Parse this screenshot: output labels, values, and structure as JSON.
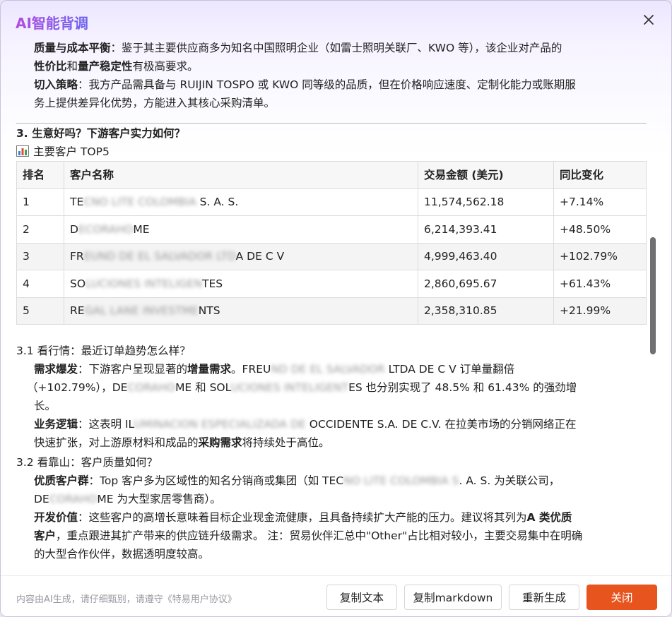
{
  "dialog": {
    "title": "AI智能背调",
    "close_icon": "close-icon"
  },
  "intro": {
    "quality_label": "质量与成本平衡",
    "quality_text_1": "：鉴于其主要供应商多为知名中国照明企业（如雷士照明关联厂、KWO 等），该企业对产品的",
    "quality_bold_1": "性价比",
    "quality_and": "和",
    "quality_bold_2": "量产稳定性",
    "quality_text_2": "有极高要求。",
    "strategy_label": "切入策略",
    "strategy_text_1": "：我方产品需具备与 RUIJIN TOSPO 或 KWO 同等级的品质，但在价格响应速度、定制化能力或账期服",
    "strategy_text_2": "务上提供差异化优势，方能进入其核心采购清单。"
  },
  "section3": {
    "heading": "3. 生意好吗？下游客户实力如何？",
    "subheading": "主要客户 TOP5",
    "chart_icon": "bar-chart-icon"
  },
  "table": {
    "headers": [
      "排名",
      "客户名称",
      "交易金额 (美元)",
      "同比变化"
    ],
    "rows": [
      {
        "rank": "1",
        "name_a": "TE",
        "name_blur": "CNO LITE COLOMBIA",
        "name_b": " S. A. S.",
        "amount": "11,574,562.18",
        "change": "+7.14%"
      },
      {
        "rank": "2",
        "name_a": "D",
        "name_blur": "ECORAHO",
        "name_b": "ME",
        "amount": "6,214,393.41",
        "change": "+48.50%"
      },
      {
        "rank": "3",
        "name_a": "FR",
        "name_blur": "EUND DE EL SALVADOR LTD",
        "name_b": "A DE C V",
        "amount": "4,999,463.40",
        "change": "+102.79%"
      },
      {
        "rank": "4",
        "name_a": "SO",
        "name_blur": "LUCIONES INTELIGEN",
        "name_b": "TES",
        "amount": "2,860,695.67",
        "change": "+61.43%"
      },
      {
        "rank": "5",
        "name_a": "RE",
        "name_blur": "GAL LANE INVESTME",
        "name_b": "NTS",
        "amount": "2,358,310.85",
        "change": "+21.99%"
      }
    ]
  },
  "s31": {
    "heading": "3.1 看行情：最近订单趋势怎么样？",
    "demand_label": "需求爆发",
    "demand_t1": "：下游客户呈现显著的",
    "demand_bold": "增量需求",
    "demand_t2": "。FREU",
    "demand_blur1": "ND DE EL SALVADOR",
    "demand_t3": " LTDA DE C V 订单量翻倍",
    "demand_t4": "（+102.79%），DE",
    "demand_blur2": "CORAHO",
    "demand_t5": "ME 和 SOL",
    "demand_blur3": "UCIONES INTELIGENT",
    "demand_t6": "ES 也分别实现了 48.5% 和 61.43% 的强劲增",
    "demand_t7": "长。",
    "logic_label": "业务逻辑",
    "logic_t1": "：这表明 IL",
    "logic_blur": "UMINACION ESPECIALIZADA DE",
    "logic_t2": " OCCIDENTE S.A. DE C.V. 在拉美市场的分销网络正在",
    "logic_t3": "快速扩张，对上游原材料和成品的",
    "logic_bold": "采购需求",
    "logic_t4": "将持续处于高位。"
  },
  "s32": {
    "heading": "3.2 看靠山：客户质量如何？",
    "quality_label": "优质客户群",
    "quality_t1": "：Top 客户多为区域性的知名分销商或集团（如 TEC",
    "quality_blur": "NO LITE COLOMBIA S",
    "quality_t2": ". A. S. 为关联公司，",
    "quality_t3": "DE",
    "quality_blur2": "CORAHO",
    "quality_t4": "ME 为大型家居零售商）。",
    "value_label": "开发价值",
    "value_t1": "：这些客户的高增长意味着目标企业现金流健康，且具备持续扩大产能的压力。建议将其列为",
    "value_bold": "A 类优质",
    "value_bold2": "客户",
    "value_t2": "，重点跟进其扩产带来的供应链升级需求。 注：贸易伙伴汇总中\"Other\"占比相对较小，主要交易集中在明确",
    "value_t3": "的大型合作伙伴，数据透明度较高。"
  },
  "footer": {
    "disclaimer": "内容由AI生成，请仔细甄别，请遵守《特易用户协议》",
    "copy_text": "复制文本",
    "copy_markdown": "复制markdown",
    "regenerate": "重新生成",
    "close": "关闭"
  },
  "colors": {
    "primary": "#e8541e",
    "title_gradient_start": "#b04ee0",
    "title_gradient_end": "#6c63f0"
  }
}
